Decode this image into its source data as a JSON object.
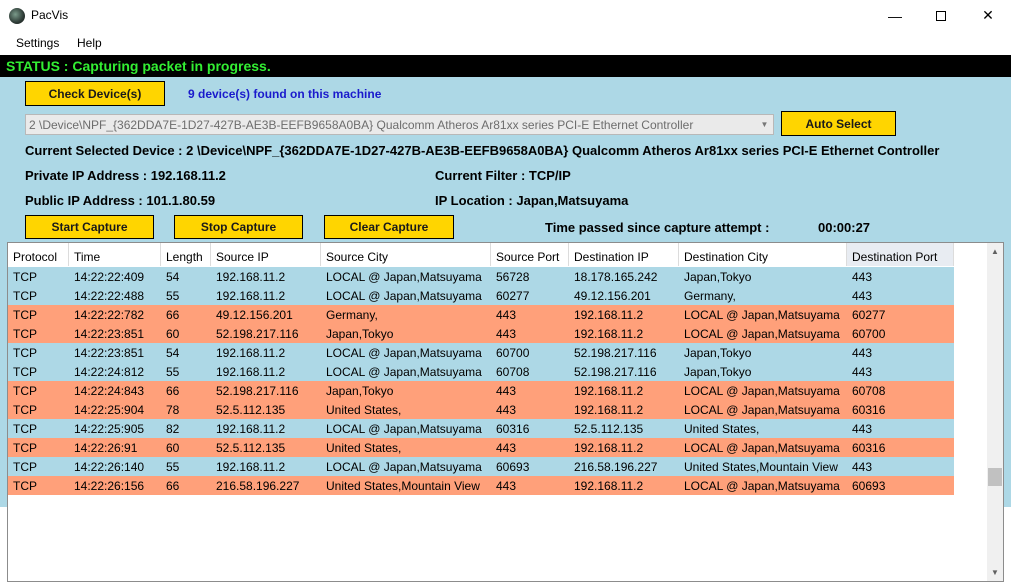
{
  "window": {
    "title": "PacVis",
    "minimize_glyph": "—",
    "close_glyph": "✕"
  },
  "menu": [
    "Settings",
    "Help"
  ],
  "status": "STATUS : Capturing packet in progress.",
  "controls": {
    "check_devices": "Check Device(s)",
    "devices_found": "9 device(s) found on this machine",
    "device_value": "2 \\Device\\NPF_{362DDA7E-1D27-427B-AE3B-EEFB9658A0BA}  Qualcomm Atheros Ar81xx series PCI-E Ethernet Controller",
    "auto_select": "Auto Select",
    "start_capture": "Start Capture",
    "stop_capture": "Stop Capture",
    "clear_capture": "Clear Capture"
  },
  "info": {
    "current_device": "Current Selected Device : 2 \\Device\\NPF_{362DDA7E-1D27-427B-AE3B-EEFB9658A0BA}  Qualcomm Atheros Ar81xx series PCI-E Ethernet Controller",
    "private_ip": "Private IP Address : 192.168.11.2",
    "current_filter": "Current Filter : TCP/IP",
    "public_ip": "Public IP Address : 101.1.80.59",
    "ip_location": "IP Location : Japan,Matsuyama",
    "time_passed_label": "Time passed since capture attempt :",
    "time_passed_value": "00:00:27"
  },
  "colors": {
    "outgoing_row": "#add8e6",
    "incoming_row": "#ffa07a",
    "button": "#ffd500",
    "status_text": "#33ee33"
  },
  "icons": {
    "scroll_up": "▲",
    "scroll_down": "▼",
    "dropdown": "▼"
  },
  "table": {
    "columns": [
      "Protocol",
      "Time",
      "Length",
      "Source IP",
      "Source City",
      "Source Port",
      "Destination IP",
      "Destination City",
      "Destination Port"
    ],
    "rows": [
      {
        "dir": "out",
        "cells": [
          "TCP",
          "14:22:22:409",
          "54",
          "192.168.11.2",
          "LOCAL @ Japan,Matsuyama",
          "56728",
          "18.178.165.242",
          "Japan,Tokyo",
          "443"
        ]
      },
      {
        "dir": "out",
        "cells": [
          "TCP",
          "14:22:22:488",
          "55",
          "192.168.11.2",
          "LOCAL @ Japan,Matsuyama",
          "60277",
          "49.12.156.201",
          "Germany,",
          "443"
        ]
      },
      {
        "dir": "in",
        "cells": [
          "TCP",
          "14:22:22:782",
          "66",
          "49.12.156.201",
          "Germany,",
          "443",
          "192.168.11.2",
          "LOCAL @ Japan,Matsuyama",
          "60277"
        ]
      },
      {
        "dir": "in",
        "cells": [
          "TCP",
          "14:22:23:851",
          "60",
          "52.198.217.116",
          "Japan,Tokyo",
          "443",
          "192.168.11.2",
          "LOCAL @ Japan,Matsuyama",
          "60700"
        ]
      },
      {
        "dir": "out",
        "cells": [
          "TCP",
          "14:22:23:851",
          "54",
          "192.168.11.2",
          "LOCAL @ Japan,Matsuyama",
          "60700",
          "52.198.217.116",
          "Japan,Tokyo",
          "443"
        ]
      },
      {
        "dir": "out",
        "cells": [
          "TCP",
          "14:22:24:812",
          "55",
          "192.168.11.2",
          "LOCAL @ Japan,Matsuyama",
          "60708",
          "52.198.217.116",
          "Japan,Tokyo",
          "443"
        ]
      },
      {
        "dir": "in",
        "cells": [
          "TCP",
          "14:22:24:843",
          "66",
          "52.198.217.116",
          "Japan,Tokyo",
          "443",
          "192.168.11.2",
          "LOCAL @ Japan,Matsuyama",
          "60708"
        ]
      },
      {
        "dir": "in",
        "cells": [
          "TCP",
          "14:22:25:904",
          "78",
          "52.5.112.135",
          "United States,",
          "443",
          "192.168.11.2",
          "LOCAL @ Japan,Matsuyama",
          "60316"
        ]
      },
      {
        "dir": "out",
        "cells": [
          "TCP",
          "14:22:25:905",
          "82",
          "192.168.11.2",
          "LOCAL @ Japan,Matsuyama",
          "60316",
          "52.5.112.135",
          "United States,",
          "443"
        ]
      },
      {
        "dir": "in",
        "cells": [
          "TCP",
          "14:22:26:91",
          "60",
          "52.5.112.135",
          "United States,",
          "443",
          "192.168.11.2",
          "LOCAL @ Japan,Matsuyama",
          "60316"
        ]
      },
      {
        "dir": "out",
        "cells": [
          "TCP",
          "14:22:26:140",
          "55",
          "192.168.11.2",
          "LOCAL @ Japan,Matsuyama",
          "60693",
          "216.58.196.227",
          "United States,Mountain View",
          "443"
        ]
      },
      {
        "dir": "in",
        "cells": [
          "TCP",
          "14:22:26:156",
          "66",
          "216.58.196.227",
          "United States,Mountain View",
          "443",
          "192.168.11.2",
          "LOCAL @ Japan,Matsuyama",
          "60693"
        ]
      }
    ]
  }
}
